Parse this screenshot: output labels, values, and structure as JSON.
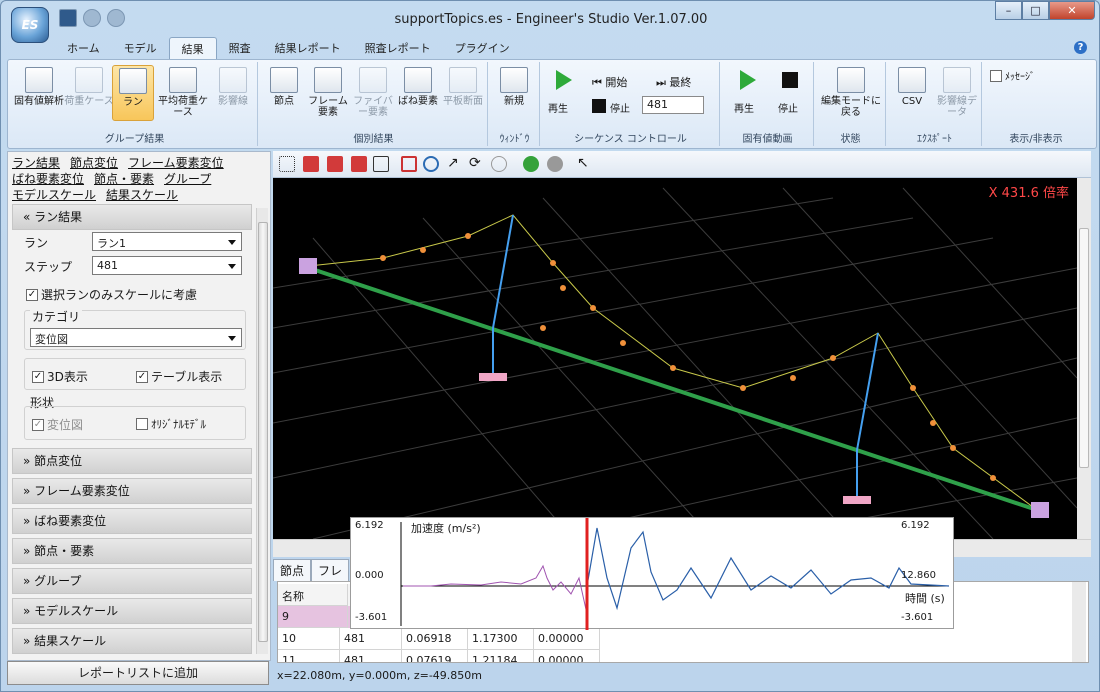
{
  "window": {
    "title": "supportTopics.es - Engineer's Studio Ver.1.07.00",
    "logo": "ES"
  },
  "tabs": [
    "ホーム",
    "モデル",
    "結果",
    "照査",
    "結果レポート",
    "照査レポート",
    "プラグイン"
  ],
  "ribbon": {
    "groups": [
      {
        "label": "グループ結果",
        "buttons": [
          "固有値解析",
          "荷重ケース",
          "ラン",
          "平均荷重ケース",
          "影響線"
        ]
      },
      {
        "label": "個別結果",
        "buttons": [
          "節点",
          "フレーム要素",
          "ファイバー要素",
          "ばね要素",
          "平板断面"
        ]
      },
      {
        "label": "ｳｨﾝﾄﾞｳ",
        "buttons": [
          "新規"
        ]
      },
      {
        "label": "シーケンス コントロール",
        "play": "再生",
        "stop": "停止",
        "start": "開始",
        "end": "最終",
        "step": "481"
      },
      {
        "label": "固有値動画",
        "play": "再生",
        "stop": "停止"
      },
      {
        "label": "状態",
        "buttons": [
          "編集モードに戻る"
        ]
      },
      {
        "label": "ｴｸｽﾎﾟｰﾄ",
        "buttons": [
          "CSV",
          "影響線データ"
        ]
      },
      {
        "label": "表示/非表示",
        "message": "ﾒｯｾｰｼﾞ"
      }
    ]
  },
  "left": {
    "links": [
      "ラン結果",
      "節点変位",
      "フレーム要素変位",
      "ばね要素変位",
      "節点・要素",
      "グループ",
      "モデルスケール",
      "結果スケール"
    ],
    "run_section": "ラン結果",
    "run_label": "ラン",
    "run_value": "ラン1",
    "step_label": "ステップ",
    "step_value": "481",
    "scale_check": "選択ランのみスケールに考慮",
    "category_label": "カテゴリ",
    "category_value": "変位図",
    "display_3d": "3D表示",
    "table_display": "テーブル表示",
    "shape_label": "形状",
    "shape_deformed": "変位図",
    "shape_original": "ｵﾘｼﾞﾅﾙﾓﾃﾞﾙ",
    "sections": [
      "節点変位",
      "フレーム要素変位",
      "ばね要素変位",
      "節点・要素",
      "グループ",
      "モデルスケール",
      "結果スケール"
    ],
    "report_button": "レポートリストに追加"
  },
  "viewport": {
    "scale": "X 431.6 倍率"
  },
  "graph": {
    "ymax": "6.192",
    "yzero": "0.000",
    "ymin": "-3.601",
    "ylabel": "加速度 (m/s²)",
    "xlabel": "時間 (s)",
    "xmax": "12.860",
    "rmax": "6.192",
    "rmin": "-3.601"
  },
  "bottom": {
    "tabs": [
      "節点",
      "フレ"
    ],
    "header": "名称",
    "rows": [
      [
        "9",
        "",
        "",
        "",
        ""
      ],
      [
        "10",
        "481",
        "0.06918",
        "1.17300",
        "0.00000"
      ],
      [
        "11",
        "481",
        "0.07619",
        "1.21184",
        "0.00000"
      ]
    ]
  },
  "status": "x=22.080m, y=0.000m, z=-49.850m",
  "colors": {
    "accent": "#2eaa3a",
    "scale_text": "#ff4848"
  }
}
